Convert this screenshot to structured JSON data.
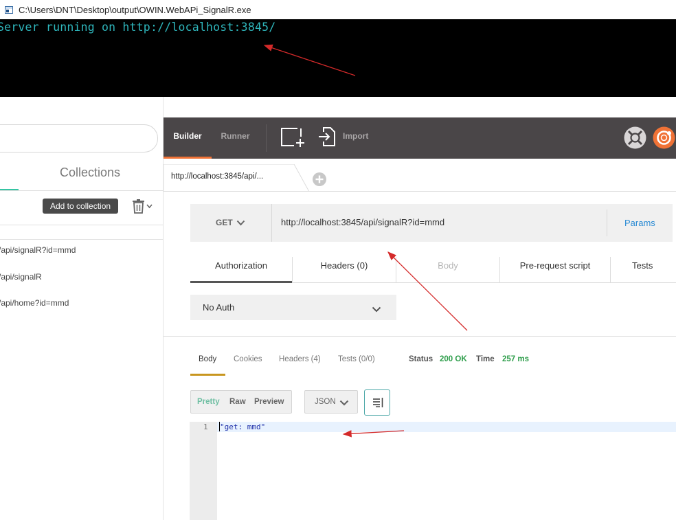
{
  "console": {
    "title": "C:\\Users\\DNT\\Desktop\\output\\OWIN.WebAPi_SignalR.exe",
    "output": "Server running on http://localhost:3845/"
  },
  "sidebar": {
    "search_placeholder": "",
    "collections_tab": "Collections",
    "add_to_collection": "Add to collection",
    "history": [
      "/api/signalR?id=mmd",
      "/api/signalR",
      "/api/home?id=mmd"
    ]
  },
  "toolbar": {
    "builder": "Builder",
    "runner": "Runner",
    "import": "Import"
  },
  "request_tab": {
    "label": "http://localhost:3845/api/..."
  },
  "request": {
    "method": "GET",
    "url": "http://localhost:3845/api/signalR?id=mmd",
    "params": "Params",
    "tabs": [
      "Authorization",
      "Headers (0)",
      "Body",
      "Pre-request script",
      "Tests"
    ],
    "auth_type": "No Auth"
  },
  "response": {
    "tabs": [
      "Body",
      "Cookies",
      "Headers (4)",
      "Tests (0/0)"
    ],
    "status_label": "Status",
    "status_value": "200 OK",
    "time_label": "Time",
    "time_value": "257 ms",
    "view_options": [
      "Pretty",
      "Raw",
      "Preview"
    ],
    "format": "JSON",
    "line_number": "1",
    "body": "\"get: mmd\""
  },
  "colors": {
    "console_text": "#2fb7bd",
    "topbar": "#4a4648",
    "builder_accent": "#f07236",
    "status_ok": "#2d9d4a",
    "link_blue": "#2a8bd4",
    "annotation_arrow": "#d42a2a"
  }
}
